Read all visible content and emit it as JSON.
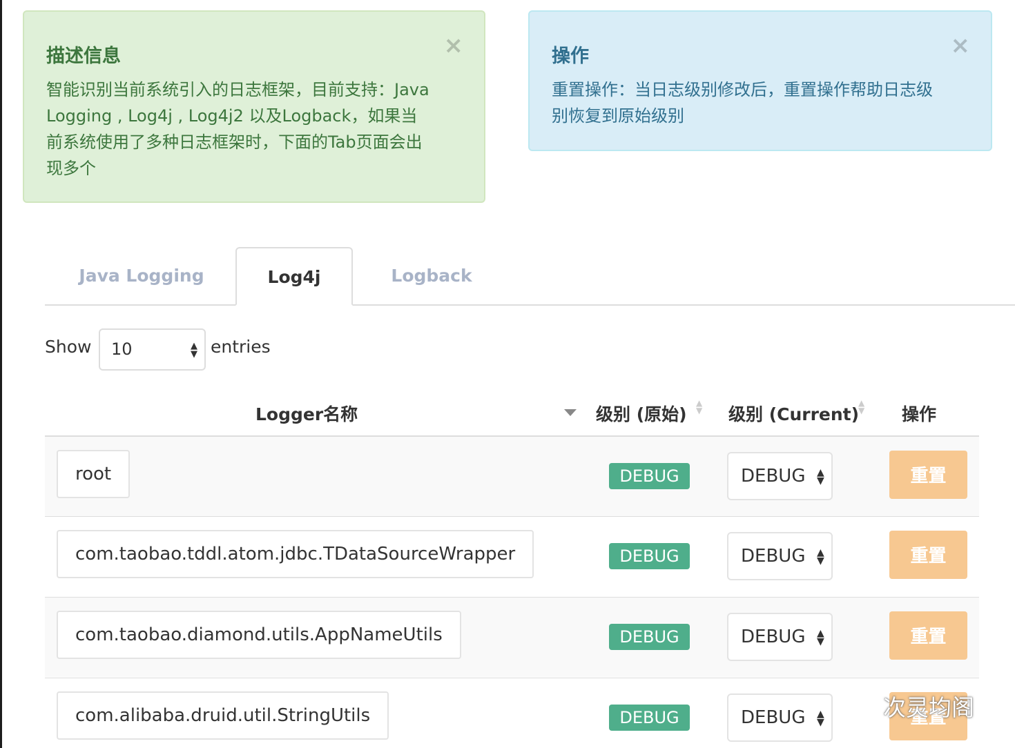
{
  "alerts": {
    "description": {
      "title": "描述信息",
      "body": "智能识别当前系统引入的日志框架，目前支持：Java Logging , Log4j , Log4j2 以及Logback，如果当前系统使用了多种日志框架时，下面的Tab页面会出现多个",
      "close": "×"
    },
    "operation": {
      "title": "操作",
      "body": "重置操作：当日志级别修改后，重置操作帮助日志级别恢复到原始级别",
      "close": "×"
    }
  },
  "tabs": [
    {
      "label": "Java Logging",
      "active": false
    },
    {
      "label": "Log4j",
      "active": true
    },
    {
      "label": "Logback",
      "active": false
    }
  ],
  "length_menu": {
    "show_label": "Show",
    "value": "10",
    "entries_label": "entries"
  },
  "table": {
    "headers": {
      "name": "Logger名称",
      "level_original": "级别 (原始)",
      "level_current": "级别 (Current)",
      "action": "操作"
    },
    "rows": [
      {
        "name": "root",
        "original": "DEBUG",
        "current": "DEBUG",
        "action": "重置"
      },
      {
        "name": "com.taobao.tddl.atom.jdbc.TDataSourceWrapper",
        "original": "DEBUG",
        "current": "DEBUG",
        "action": "重置"
      },
      {
        "name": "com.taobao.diamond.utils.AppNameUtils",
        "original": "DEBUG",
        "current": "DEBUG",
        "action": "重置"
      },
      {
        "name": "com.alibaba.druid.util.StringUtils",
        "original": "DEBUG",
        "current": "DEBUG",
        "action": "重置"
      }
    ]
  },
  "watermark": {
    "text": "次灵均阁",
    "icon": "wechat-icon"
  },
  "colors": {
    "success_bg": "#dff0d8",
    "info_bg": "#d9edf7",
    "badge": "#4fae8b",
    "reset_button": "#f7c891"
  }
}
